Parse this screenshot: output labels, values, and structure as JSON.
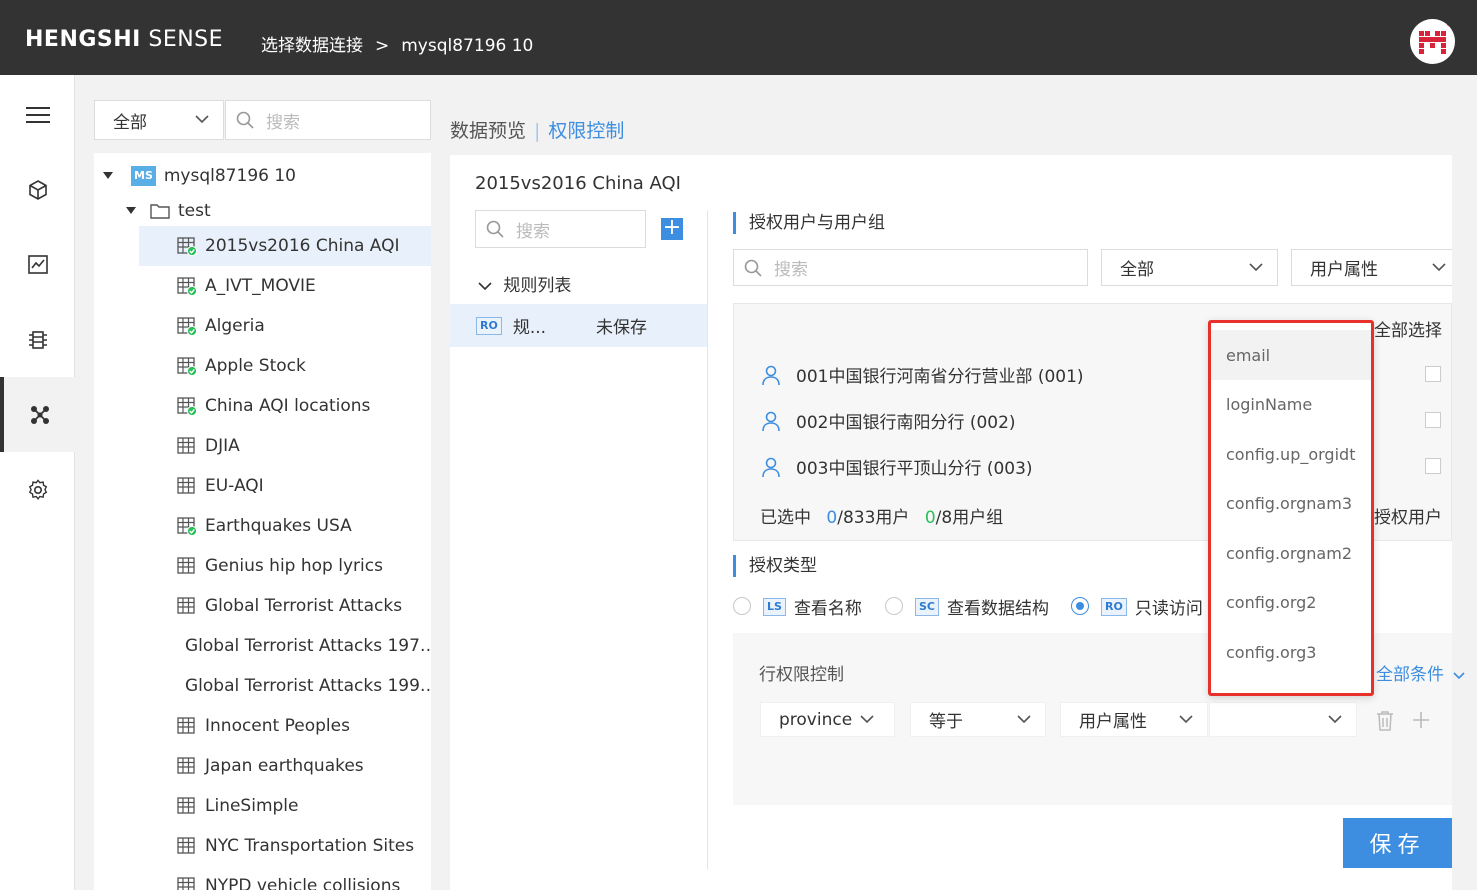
{
  "header": {
    "brand_bold": "HENGSHI",
    "brand_rest": " SENSE",
    "breadcrumb": [
      "选择数据连接",
      "mysql87196 10"
    ],
    "breadcrumb_sep": ">"
  },
  "left_nav": {
    "items": [
      "menu-icon",
      "cube-icon",
      "chart-icon",
      "dataset-icon",
      "connection-icon",
      "settings-icon"
    ],
    "active_index": 4
  },
  "tree": {
    "filter_value": "全部",
    "search_placeholder": "搜索",
    "root_badge": "MS",
    "root_label": "mysql87196 10",
    "folder_label": "test",
    "items": [
      {
        "label": "2015vs2016 China AQI",
        "checked": true,
        "selected": true
      },
      {
        "label": "A_IVT_MOVIE",
        "checked": true
      },
      {
        "label": "Algeria",
        "checked": true
      },
      {
        "label": "Apple Stock",
        "checked": true
      },
      {
        "label": "China AQI locations",
        "checked": true
      },
      {
        "label": "DJIA",
        "checked": false
      },
      {
        "label": "EU-AQI",
        "checked": false
      },
      {
        "label": "Earthquakes USA",
        "checked": true
      },
      {
        "label": "Genius hip hop lyrics",
        "checked": false
      },
      {
        "label": "Global Terrorist Attacks",
        "checked": false
      },
      {
        "label": "Global Terrorist Attacks 197…",
        "checked": false
      },
      {
        "label": "Global Terrorist Attacks 199…",
        "checked": false
      },
      {
        "label": "Innocent Peoples",
        "checked": false
      },
      {
        "label": "Japan earthquakes",
        "checked": false
      },
      {
        "label": "LineSimple",
        "checked": false
      },
      {
        "label": "NYC Transportation Sites",
        "checked": false
      },
      {
        "label": "NYPD vehicle collisions",
        "checked": false
      }
    ]
  },
  "tabs": {
    "preview": "数据预览",
    "permission": "权限控制",
    "active": "permission"
  },
  "table_name": "2015vs2016 China AQI",
  "rules": {
    "search_placeholder": "搜索",
    "add_label": "+",
    "list_title": "规则列表",
    "item_badge": "RO",
    "item_label": "规...",
    "item_status": "未保存"
  },
  "auth_users": {
    "title": "授权用户与用户组",
    "search_placeholder": "搜索",
    "filter_value": "全部",
    "attr_value": "用户属性",
    "select_all": "全部选择",
    "users": [
      "001中国银行河南省分行营业部 (001)",
      "002中国银行南阳分行 (002)",
      "003中国银行平顶山分行 (003)"
    ],
    "selected_prefix": "已选中",
    "selected_users_count": "0",
    "users_total": "/833用户",
    "selected_groups_count": "0",
    "groups_total": "/8用户组",
    "auth_users_link": "授权用户"
  },
  "auth_type": {
    "title": "授权类型",
    "options": [
      {
        "badge": "LS",
        "label": "查看名称",
        "selected": false
      },
      {
        "badge": "SC",
        "label": "查看数据结构",
        "selected": false
      },
      {
        "badge": "RO",
        "label": "只读访问",
        "selected": true
      }
    ]
  },
  "row_permission": {
    "title": "行权限控制",
    "all_conditions": "全部条件",
    "field": "province",
    "operator": "等于",
    "value_type": "用户属性",
    "value": ""
  },
  "dropdown": {
    "options": [
      "email",
      "loginName",
      "config.up_orgidt",
      "config.orgnam3",
      "config.orgnam2",
      "config.org2",
      "config.org3"
    ],
    "highlighted_index": 0
  },
  "save_label": "保存",
  "colors": {
    "accent": "#3d8ee0",
    "topbar": "#333333",
    "highlight_border": "#e8302a",
    "check_green": "#2bbf5a"
  }
}
